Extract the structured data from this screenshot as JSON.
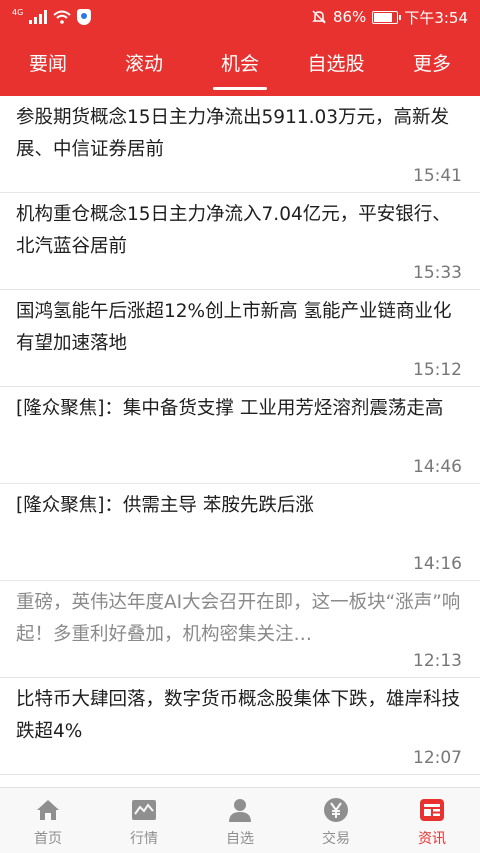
{
  "statusbar": {
    "network": "4G",
    "battery": "86%",
    "battery_level": 0.86,
    "time": "下午3:54"
  },
  "tabs": [
    {
      "label": "要闻",
      "active": false
    },
    {
      "label": "滚动",
      "active": false
    },
    {
      "label": "机会",
      "active": true
    },
    {
      "label": "自选股",
      "active": false
    },
    {
      "label": "更多",
      "active": false
    }
  ],
  "news": [
    {
      "title": "参股期货概念15日主力净流出5911.03万元，高新发展、中信证券居前",
      "time": "15:41",
      "read": false
    },
    {
      "title": "机构重仓概念15日主力净流入7.04亿元，平安银行、北汽蓝谷居前",
      "time": "15:33",
      "read": false
    },
    {
      "title": "国鸿氢能午后涨超12%创上市新高 氢能产业链商业化有望加速落地",
      "time": "15:12",
      "read": false
    },
    {
      "title": "[隆众聚焦]：集中备货支撑 工业用芳烃溶剂震荡走高",
      "time": "14:46",
      "read": false
    },
    {
      "title": "[隆众聚焦]：供需主导 苯胺先跌后涨",
      "time": "14:16",
      "read": false
    },
    {
      "title": "重磅，英伟达年度AI大会召开在即，这一板块“涨声”响起！多重利好叠加，机构密集关注…",
      "time": "12:13",
      "read": true
    },
    {
      "title": "比特币大肆回落，数字货币概念股集体下跌，雄岸科技跌超4%",
      "time": "12:07",
      "read": false
    }
  ],
  "bottom_nav": [
    {
      "label": "首页",
      "icon": "home-icon",
      "active": false
    },
    {
      "label": "行情",
      "icon": "chart-icon",
      "active": false
    },
    {
      "label": "自选",
      "icon": "person-icon",
      "active": false
    },
    {
      "label": "交易",
      "icon": "yen-coin-icon",
      "active": false
    },
    {
      "label": "资讯",
      "icon": "news-icon",
      "active": true
    }
  ],
  "colors": {
    "brand_red": "#e8322f",
    "inactive_gray": "#8f8f8f"
  }
}
